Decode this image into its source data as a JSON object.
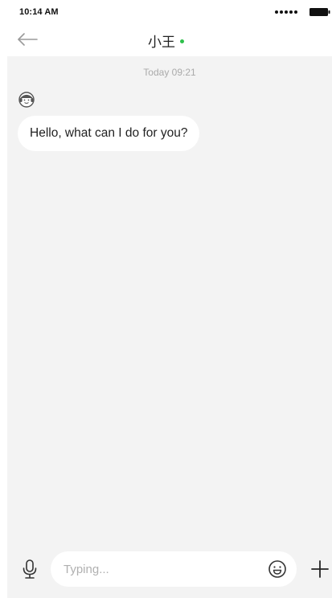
{
  "status_bar": {
    "time": "10:14 AM",
    "signal_icon": "signal-dots-icon",
    "battery_icon": "battery-icon"
  },
  "header": {
    "back_icon": "arrow-left-icon",
    "title": "小王",
    "online_indicator_color": "#2ec04b"
  },
  "chat": {
    "timestamp": "Today 09:21",
    "messages": [
      {
        "sender_avatar_icon": "agent-avatar-icon",
        "text": "Hello, what can I do for you?"
      }
    ]
  },
  "input_bar": {
    "voice_icon": "microphone-icon",
    "placeholder": "Typing...",
    "value": "",
    "emoji_icon": "smiley-icon",
    "add_icon": "plus-icon"
  },
  "colors": {
    "chat_background": "#f3f3f3",
    "bubble_background": "#ffffff",
    "timestamp_text": "#aaaaaa",
    "placeholder_text": "#b0b0b0"
  }
}
